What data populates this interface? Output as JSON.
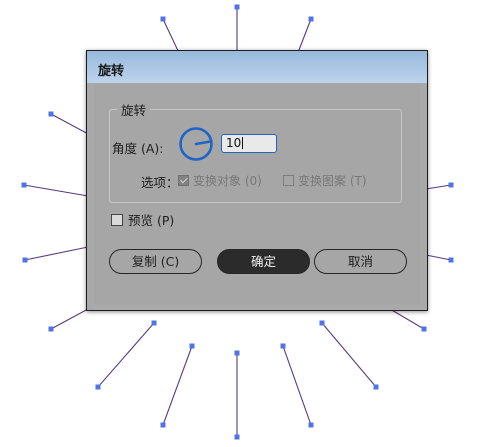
{
  "dialog": {
    "title": "旋转",
    "section_title": "旋转",
    "angle_label": "角度 (A):",
    "angle_value": "10",
    "options_label": "选项：",
    "transform_objects_label": "变换对象 (0)",
    "transform_objects_checked": true,
    "transform_patterns_label": "变换图案 (T)",
    "transform_patterns_checked": false,
    "preview_label": "预览 (P)",
    "preview_checked": false,
    "copy_button": "复制 (C)",
    "ok_button": "确定",
    "cancel_button": "取消"
  },
  "colors": {
    "ray": "#5a3a7e",
    "handle": "#4f74e6",
    "dial": "#1f64c6",
    "titlebar": "#a9c6e6"
  }
}
